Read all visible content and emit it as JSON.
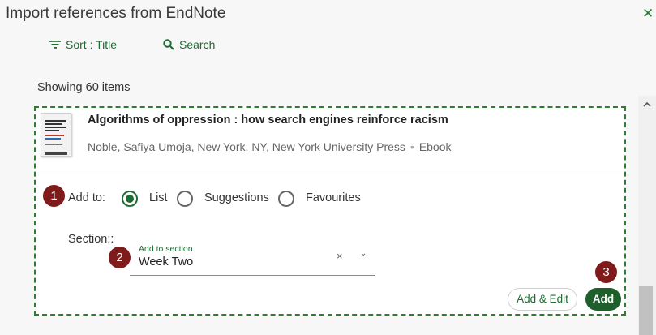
{
  "dialog": {
    "title": "Import references from EndNote",
    "close_icon": "close-icon"
  },
  "toolbar": {
    "sort_label": "Sort : Title",
    "sort_icon": "sort-icon",
    "search_label": "Search",
    "search_icon": "search-icon"
  },
  "results": {
    "count_label": "Showing 60 items"
  },
  "item": {
    "cover_icon": "book-cover-thumbnail",
    "title": "Algorithms of oppression : how search engines reinforce racism",
    "meta": "Noble, Safiya Umoja, New York, NY, New York University Press",
    "separator": "•",
    "format": "Ebook"
  },
  "add_to": {
    "label": "Add to:",
    "options": [
      {
        "label": "List",
        "checked": true
      },
      {
        "label": "Suggestions",
        "checked": false
      },
      {
        "label": "Favourites",
        "checked": false
      }
    ]
  },
  "section": {
    "label": "Section::",
    "floating_label": "Add to section",
    "value": "Week Two",
    "clear_icon": "×",
    "caret_icon": "⌄"
  },
  "actions": {
    "add_edit_label": "Add & Edit",
    "add_label": "Add"
  },
  "steps": [
    "1",
    "2",
    "3"
  ],
  "colors": {
    "accent_green": "#1f6b32",
    "dashed_border": "#2e7d32",
    "step_badge": "#7f1b1b",
    "primary_button": "#1e5f2b"
  }
}
